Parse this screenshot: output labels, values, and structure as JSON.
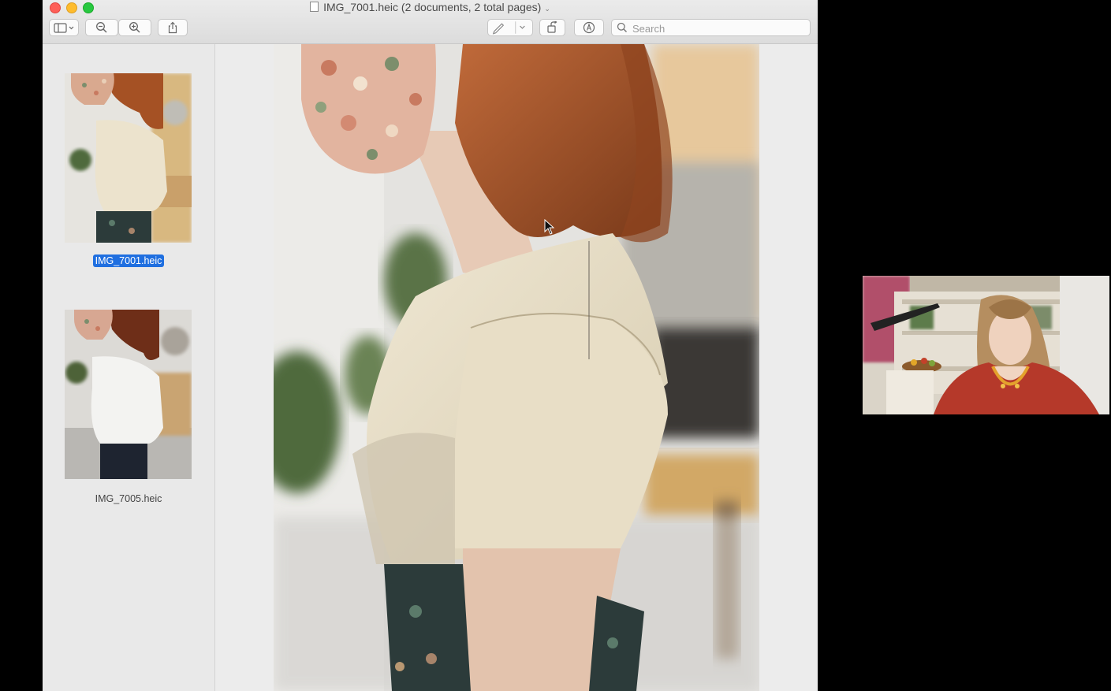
{
  "window": {
    "title": "IMG_7001.heic (2 documents, 2 total pages)"
  },
  "toolbar": {
    "search_placeholder": "Search"
  },
  "sidebar": {
    "items": [
      {
        "label": "IMG_7001.heic",
        "selected": true
      },
      {
        "label": "IMG_7005.heic",
        "selected": false
      }
    ]
  },
  "colors": {
    "selection": "#1f6fe0",
    "close": "#fe5f57",
    "minimize": "#febc2e",
    "maximize": "#28c840"
  }
}
